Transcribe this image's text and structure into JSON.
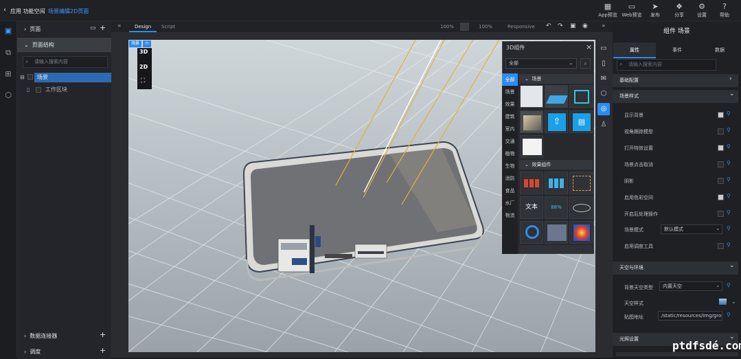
{
  "header": {
    "back_icon": "chevron-left-icon",
    "app_name": "应用 功能空间",
    "separator": "/",
    "current_page": "场景编辑2D页面",
    "tools": [
      {
        "icon": "qr-icon",
        "label": "App预览"
      },
      {
        "icon": "monitor-icon",
        "label": "Web预览"
      },
      {
        "icon": "send-icon",
        "label": "发布"
      },
      {
        "icon": "share-icon",
        "label": "分享"
      },
      {
        "icon": "gear-icon",
        "label": "设置"
      },
      {
        "icon": "help-icon",
        "label": "帮助"
      }
    ]
  },
  "left_panel": {
    "pages_label": "页面",
    "structure_label": "页面结构",
    "search_placeholder": "请输入搜索内容",
    "tree": [
      {
        "label": "场景"
      },
      {
        "label": "工作区块"
      }
    ],
    "datasource_label": "数据连接器",
    "bottom_label": "调度"
  },
  "canvas_toolbar": {
    "collapse": "«",
    "tab_design": "Design",
    "tab_script": "Script",
    "zoom1": "100%",
    "zoom2": "100%",
    "responsive": "Responsive",
    "expand": "»"
  },
  "viewport": {
    "scene_badge": "场景",
    "mode_3d": "3D",
    "mode_2d": "2D",
    "fit_icon": "fullscreen-icon"
  },
  "library": {
    "title": "3D组件",
    "filter_value": "全部",
    "categories": [
      "全部",
      "场景",
      "效果",
      "建筑",
      "室内",
      "交通",
      "植物",
      "生物",
      "消防",
      "食品",
      "水厂",
      "物流"
    ],
    "group1": "场景",
    "group2": "效果组件",
    "text_tile": "文本",
    "percent_tile": "88%"
  },
  "right_panel": {
    "title": "组件 场景",
    "tabs": [
      "属性",
      "事件",
      "数据"
    ],
    "search_placeholder": "请输入搜索内容",
    "section_basic": "基础配置",
    "section_scene": "场景样式",
    "props": [
      {
        "label": "显示背景",
        "checked": true
      },
      {
        "label": "视角跟踪模型",
        "checked": false
      },
      {
        "label": "打开特效设置",
        "checked": true
      },
      {
        "label": "场景点击取消",
        "checked": false
      },
      {
        "label": "阴影",
        "checked": false
      },
      {
        "label": "启用色彩空间",
        "checked": true
      },
      {
        "label": "开启后处理操作",
        "checked": false
      },
      {
        "label": "场景模式",
        "value": "默认模式"
      },
      {
        "label": "启用调度工具",
        "checked": false
      }
    ],
    "section_sky": "天空与环境",
    "sky_props": [
      {
        "label": "背景天空类型",
        "value": "内置天空"
      },
      {
        "label": "天空样式",
        "value": ""
      },
      {
        "label": "贴图地址",
        "value": "/static/resources/img/groun"
      }
    ],
    "section_light": "光照设置"
  },
  "watermark": "ptdfsdé.com"
}
